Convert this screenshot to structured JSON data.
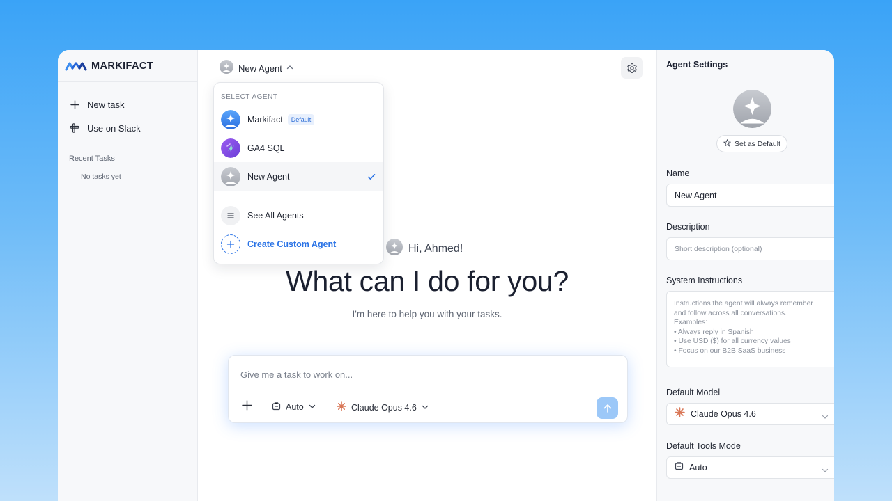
{
  "brand": {
    "name": "MARKIFACT"
  },
  "sidebar": {
    "items": [
      {
        "label": "New task",
        "icon": "plus-icon"
      },
      {
        "label": "Use on Slack",
        "icon": "slack-icon"
      }
    ],
    "recent_label": "Recent Tasks",
    "empty_text": "No tasks yet"
  },
  "header": {
    "agent_name": "New Agent"
  },
  "dropdown": {
    "heading": "SELECT AGENT",
    "agents": [
      {
        "label": "Markifact",
        "badge": "Default",
        "selected": false
      },
      {
        "label": "GA4 SQL",
        "selected": false
      },
      {
        "label": "New Agent",
        "selected": true
      }
    ],
    "see_all": "See All Agents",
    "create": "Create Custom Agent"
  },
  "hero": {
    "greeting": "Hi, Ahmed!",
    "headline": "What can I do for you?",
    "subline": "I'm here to help you with your tasks."
  },
  "composer": {
    "placeholder": "Give me a task to work on...",
    "mode": "Auto",
    "model": "Claude Opus 4.6"
  },
  "settings": {
    "title": "Agent Settings",
    "set_default": "Set as Default",
    "name_label": "Name",
    "name_value": "New Agent",
    "description_label": "Description",
    "description_placeholder": "Short description (optional)",
    "instructions_label": "System Instructions",
    "instructions_placeholder": "Instructions the agent will always remember\nand follow across all conversations.\nExamples:\n• Always reply in Spanish\n• Use USD ($) for all currency values\n• Focus on our B2B SaaS business",
    "model_label": "Default Model",
    "model_value": "Claude Opus 4.6",
    "tools_label": "Default Tools Mode",
    "tools_value": "Auto"
  },
  "colors": {
    "accent": "#2a73e6",
    "send": "#9cc8f8",
    "claude": "#d97757"
  }
}
